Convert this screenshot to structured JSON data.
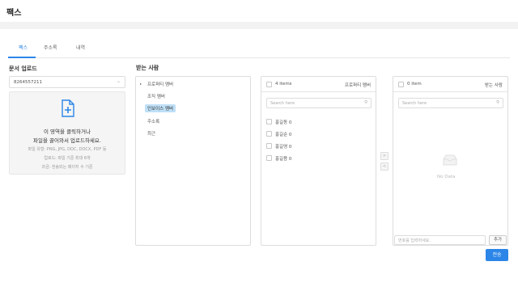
{
  "page": {
    "title": "팩스"
  },
  "tabs": [
    {
      "label": "팩스",
      "active": true
    },
    {
      "label": "주소록",
      "active": false
    },
    {
      "label": "내역",
      "active": false
    }
  ],
  "upload": {
    "title": "문서 업로드",
    "select_value": "8264557211",
    "dropzone": {
      "line1": "이 영역을 클릭하거나",
      "line2": "파일을 끌어와서 업로드하세요.",
      "info1": "파일 유형: PNG, JPG, DOC, DOCX, PDF 등",
      "info2": "업로드: 파일 기준 최대 6개",
      "info3": "과금: 전송되는 페이지 수 기준"
    }
  },
  "recipients": {
    "title": "받는 사람",
    "tree": [
      {
        "label": "프로퍼티 멤버",
        "expanded": true
      },
      {
        "label": "조직 멤버"
      },
      {
        "label": "인보이스 멤버",
        "selected": true
      },
      {
        "label": "주소록"
      },
      {
        "label": "최근"
      }
    ]
  },
  "source_list": {
    "count_label": "4 items",
    "header_right": "프로퍼티 멤버",
    "search_placeholder": "Search here",
    "items": [
      "홍길동 0",
      "홍길순 0",
      "홍길영 0",
      "홍길용 0"
    ]
  },
  "target_list": {
    "count_label": "0 item",
    "header_right": "받는 사람",
    "search_placeholder": "Search here",
    "empty_text": "No Data",
    "number_placeholder": "번호를 입력하세요.",
    "add_label": "추가"
  },
  "actions": {
    "send_label": "전송"
  },
  "colors": {
    "accent": "#2b86e8",
    "selected_bg": "#bfe0f7"
  },
  "icons": {
    "upload": "file-plus-icon",
    "search": "search-icon",
    "empty": "inbox-icon"
  }
}
